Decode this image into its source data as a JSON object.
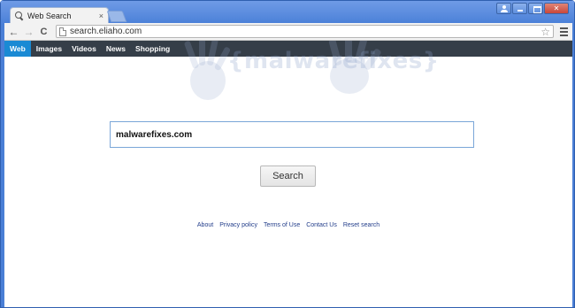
{
  "tab": {
    "title": "Web Search",
    "close": "×"
  },
  "toolbar": {
    "url": "search.eliaho.com",
    "back": "←",
    "forward": "→",
    "reload": "C",
    "bookmark": "☆"
  },
  "navbar": {
    "items": [
      "Web",
      "Images",
      "Videos",
      "News",
      "Shopping"
    ],
    "active": "Web"
  },
  "watermark": {
    "text": "{malwarefixes}"
  },
  "search": {
    "value": "malwarefixes.com",
    "button_label": "Search"
  },
  "footer": {
    "links": [
      "About",
      "Privacy policy",
      "Terms of Use",
      "Contact Us",
      "Reset search"
    ]
  },
  "colors": {
    "accent": "#1a8ad4",
    "navbar": "#353e48",
    "frame": "#4a7fd6",
    "link": "#223d8a"
  }
}
